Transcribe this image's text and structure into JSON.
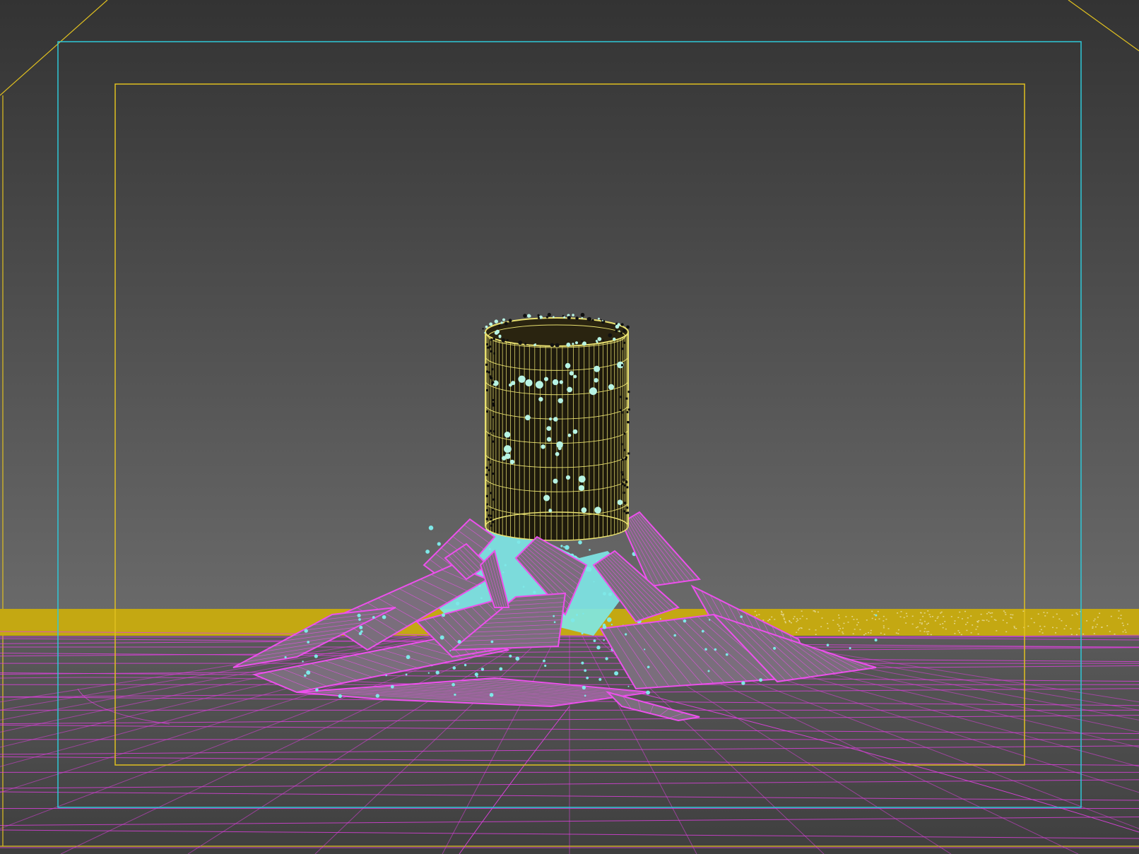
{
  "viewport": {
    "background_top": "#333333",
    "background_horizon": "#6a6a6a",
    "background_bottom": "#3e3e3e",
    "safe_frame_outer_color": "#e0c020",
    "action_safe_color": "#2fc8d8",
    "title_safe_color": "#e0c020"
  },
  "scene": {
    "ground_wire_color": "#e040e0",
    "horizon_band_color": "#c4a812",
    "cylinder_wire_color": "#e8e070",
    "cylinder_fill_color": "#1e1a0c",
    "particle_color": "#b8f4e4",
    "debris_wire_color": "#ec50ec",
    "debris_fill_color": "#7a6e7c",
    "splash_color": "#7ee8e8"
  }
}
